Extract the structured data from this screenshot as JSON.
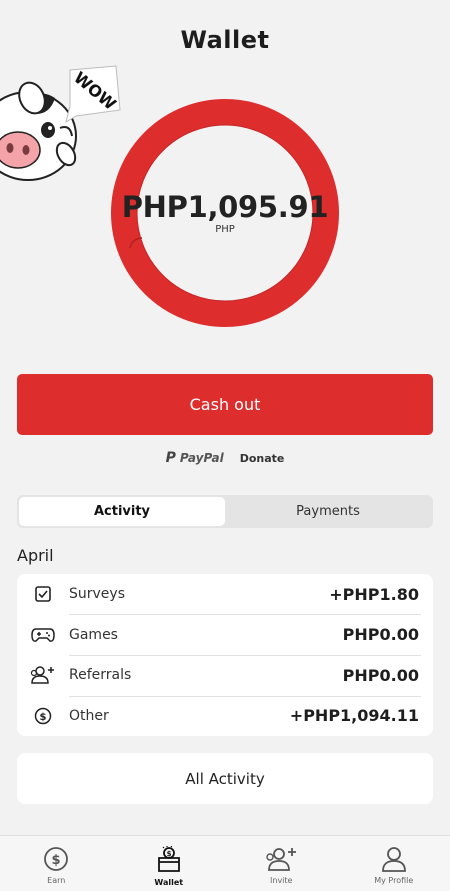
{
  "header": {
    "title": "Wallet"
  },
  "mascot": {
    "speech": "WOW"
  },
  "balance": {
    "amount": "PHP1,095.91",
    "currency": "PHP",
    "ring_color": "#de2d2d"
  },
  "actions": {
    "cashout_label": "Cash out",
    "paypal_label": "PayPal",
    "donate_label": "Donate"
  },
  "tabs": [
    {
      "label": "Activity",
      "active": true
    },
    {
      "label": "Payments",
      "active": false
    }
  ],
  "activity": {
    "month": "April",
    "items": [
      {
        "icon": "checkbox-icon",
        "label": "Surveys",
        "amount": "+PHP1.80"
      },
      {
        "icon": "gamepad-icon",
        "label": "Games",
        "amount": "PHP0.00"
      },
      {
        "icon": "add-user-icon",
        "label": "Referrals",
        "amount": "PHP0.00"
      },
      {
        "icon": "dollar-circle-icon",
        "label": "Other",
        "amount": "+PHP1,094.11"
      }
    ],
    "all_label": "All Activity"
  },
  "nav": [
    {
      "icon": "dollar-circle-icon",
      "label": "Earn",
      "active": false
    },
    {
      "icon": "wallet-icon",
      "label": "Wallet",
      "active": true
    },
    {
      "icon": "add-user-icon",
      "label": "Invite",
      "active": false
    },
    {
      "icon": "person-icon",
      "label": "My Profile",
      "active": false
    }
  ],
  "colors": {
    "accent": "#de2d2d",
    "background": "#f2f2f2"
  }
}
